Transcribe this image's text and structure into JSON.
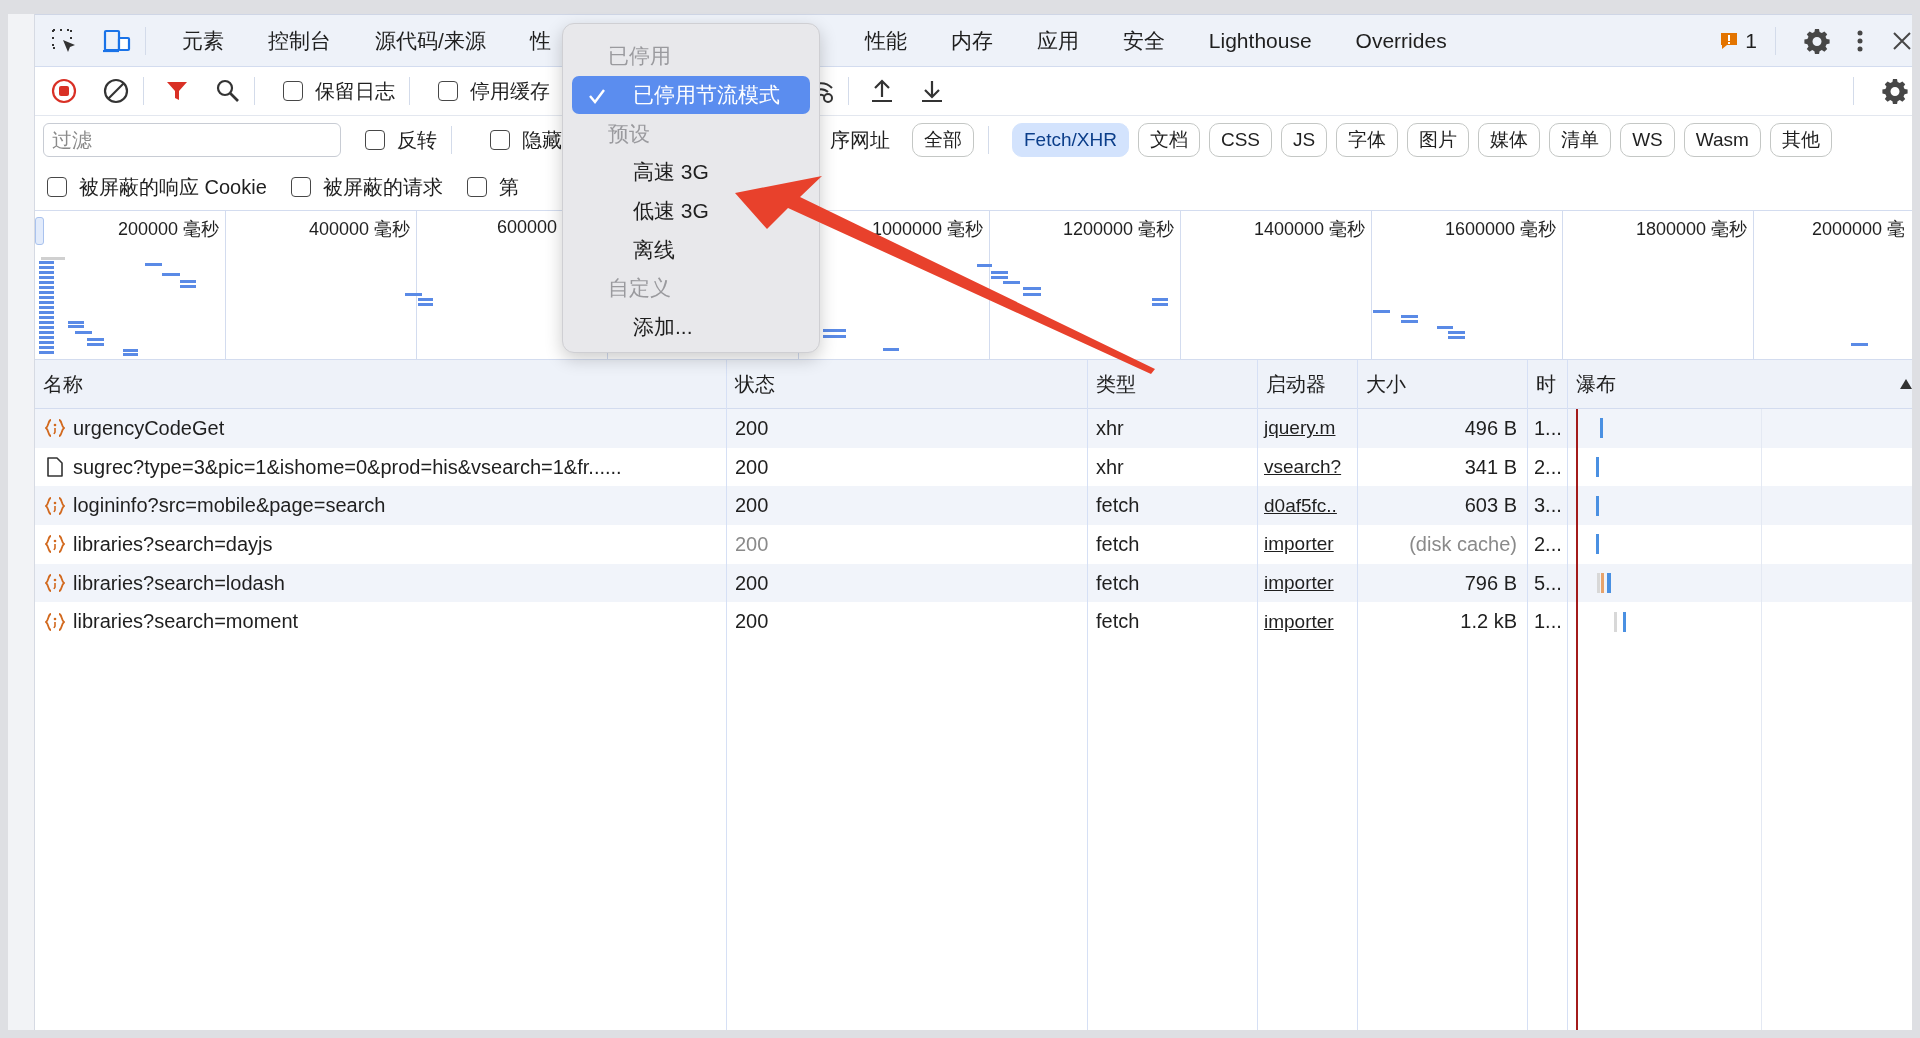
{
  "tabs": [
    {
      "label": "元素",
      "selected": false,
      "kind": "full"
    },
    {
      "label": "控制台",
      "selected": false,
      "kind": "full"
    },
    {
      "label": "源代码/来源",
      "selected": false,
      "kind": "full"
    },
    {
      "label": "性",
      "selected": false,
      "kind": "cut"
    },
    {
      "label": "性能",
      "selected": false,
      "kind": "full"
    },
    {
      "label": "内存",
      "selected": false,
      "kind": "full"
    },
    {
      "label": "应用",
      "selected": false,
      "kind": "full"
    },
    {
      "label": "安全",
      "selected": false,
      "kind": "full"
    },
    {
      "label": "Lighthouse",
      "selected": false,
      "kind": "full"
    },
    {
      "label": "Overrides",
      "selected": false,
      "kind": "full"
    }
  ],
  "issues": {
    "count": "1"
  },
  "toolbar": {
    "checkboxes": [
      {
        "label": "保留日志",
        "checked": false
      },
      {
        "label": "停用缓存",
        "checked": false
      }
    ]
  },
  "filter": {
    "placeholder": "过滤",
    "options": [
      {
        "label": "反转",
        "checked": false
      },
      {
        "label": "隐藏",
        "checked": false
      }
    ],
    "partial_label": "序网址",
    "types": [
      {
        "label": "全部",
        "selected": false
      },
      {
        "label": "Fetch/XHR",
        "selected": true
      },
      {
        "label": "文档",
        "selected": false
      },
      {
        "label": "CSS",
        "selected": false
      },
      {
        "label": "JS",
        "selected": false
      },
      {
        "label": "字体",
        "selected": false
      },
      {
        "label": "图片",
        "selected": false
      },
      {
        "label": "媒体",
        "selected": false
      },
      {
        "label": "清单",
        "selected": false
      },
      {
        "label": "WS",
        "selected": false
      },
      {
        "label": "Wasm",
        "selected": false
      },
      {
        "label": "其他",
        "selected": false
      }
    ]
  },
  "blocked_options": [
    {
      "label": "被屏蔽的响应 Cookie",
      "checked": false
    },
    {
      "label": "被屏蔽的请求",
      "checked": false
    },
    {
      "label": "第",
      "checked": false
    }
  ],
  "overview": {
    "ticks": [
      {
        "label": "200000 毫秒",
        "kind": "full"
      },
      {
        "label": "400000 毫秒",
        "kind": "full"
      },
      {
        "label": "600000",
        "kind": "cut"
      },
      {
        "label": "1000000 毫秒",
        "kind": "full"
      },
      {
        "label": "1200000 毫秒",
        "kind": "full"
      },
      {
        "label": "1400000 毫秒",
        "kind": "full"
      },
      {
        "label": "1600000 毫秒",
        "kind": "full"
      },
      {
        "label": "1800000 毫秒",
        "kind": "full"
      },
      {
        "label": "2000000 毫",
        "kind": "edge"
      }
    ]
  },
  "table": {
    "columns": [
      "名称",
      "状态",
      "类型",
      "启动器",
      "大小",
      "时",
      "瀑布"
    ],
    "rows": [
      {
        "name": "urgencyCodeGet",
        "kind": "fetch",
        "status": "200",
        "type": "xhr",
        "initiator": "jquery.m",
        "size": "496 B",
        "time": "1...",
        "cached": false
      },
      {
        "name": "sugrec?type=3&pic=1&ishome=0&prod=his&vsearch=1&fr......",
        "kind": "document",
        "status": "200",
        "type": "xhr",
        "initiator": "vsearch?",
        "size": "341 B",
        "time": "2...",
        "cached": false
      },
      {
        "name": "logininfo?src=mobile&page=search",
        "kind": "fetch",
        "status": "200",
        "type": "fetch",
        "initiator": "d0af5fc..",
        "size": "603 B",
        "time": "3...",
        "cached": false
      },
      {
        "name": "libraries?search=dayjs",
        "kind": "fetch",
        "status": "200",
        "type": "fetch",
        "initiator": "importer",
        "size": "(disk cache)",
        "time": "2...",
        "cached": true
      },
      {
        "name": "libraries?search=lodash",
        "kind": "fetch",
        "status": "200",
        "type": "fetch",
        "initiator": "importer",
        "size": "796 B",
        "time": "5...",
        "cached": false
      },
      {
        "name": "libraries?search=moment",
        "kind": "fetch",
        "status": "200",
        "type": "fetch",
        "initiator": "importer",
        "size": "1.2 kB",
        "time": "1...",
        "cached": false
      }
    ]
  },
  "throttle_menu": {
    "items": [
      {
        "kind": "header",
        "label": "已停用",
        "selected": false
      },
      {
        "kind": "option",
        "label": "已停用节流模式",
        "selected": true
      },
      {
        "kind": "header",
        "label": "预设",
        "selected": false
      },
      {
        "kind": "option",
        "label": "高速 3G",
        "selected": false
      },
      {
        "kind": "option",
        "label": "低速 3G",
        "selected": false
      },
      {
        "kind": "option",
        "label": "离线",
        "selected": false
      },
      {
        "kind": "header",
        "label": "自定义",
        "selected": false
      },
      {
        "kind": "option",
        "label": "添加...",
        "selected": false
      }
    ]
  }
}
